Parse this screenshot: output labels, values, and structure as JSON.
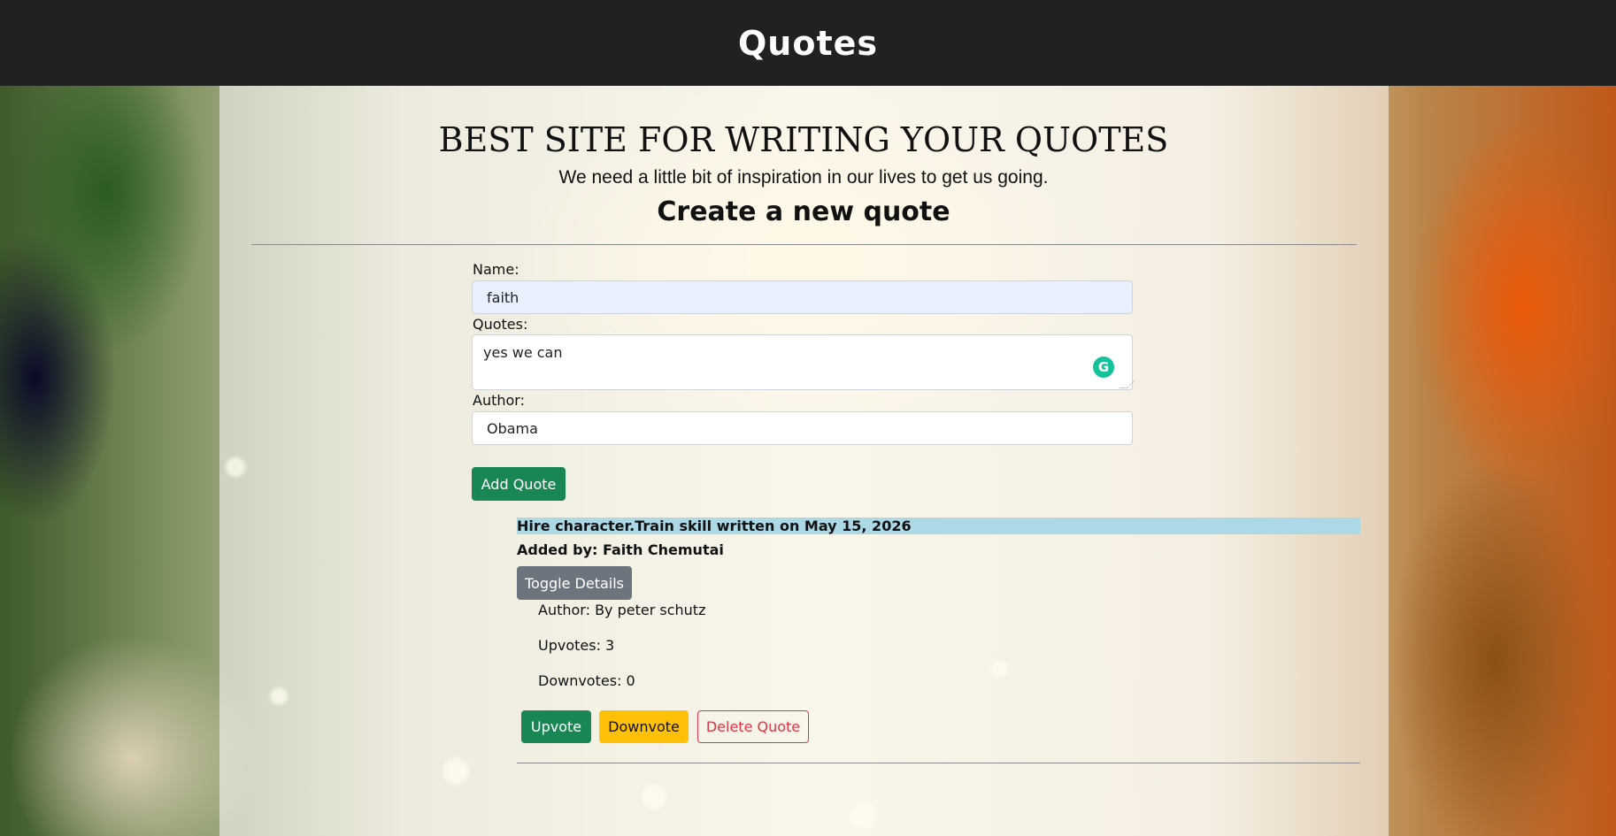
{
  "header": {
    "title": "Quotes"
  },
  "hero": {
    "title": "BEST SITE FOR WRITING YOUR QUOTES",
    "subtitle": "We need a little bit of inspiration in our lives to get us going."
  },
  "form": {
    "heading": "Create a new quote",
    "name_label": "Name:",
    "name_value": "faith",
    "quote_label": "Quotes:",
    "quote_value": "yes we can",
    "author_label": "Author:",
    "author_value": "Obama",
    "submit_label": "Add Quote"
  },
  "quotes": [
    {
      "title": "Hire character.Train skill written on May 15, 2026",
      "added_by": "Added by: Faith Chemutai",
      "toggle_label": "Toggle Details",
      "author": "Author: By peter schutz",
      "upvotes": "Upvotes: 3",
      "downvotes": "Downvotes: 0",
      "upvote_label": "Upvote",
      "downvote_label": "Downvote",
      "delete_label": "Delete Quote"
    }
  ],
  "colors": {
    "header_bg": "#212121",
    "success": "#198754",
    "secondary": "#6c757d",
    "warning": "#ffc107",
    "danger": "#dc3545",
    "highlight": "#add8e6",
    "grammarly": "#15c39a"
  },
  "icons": {
    "grammarly": "grammarly-icon"
  }
}
